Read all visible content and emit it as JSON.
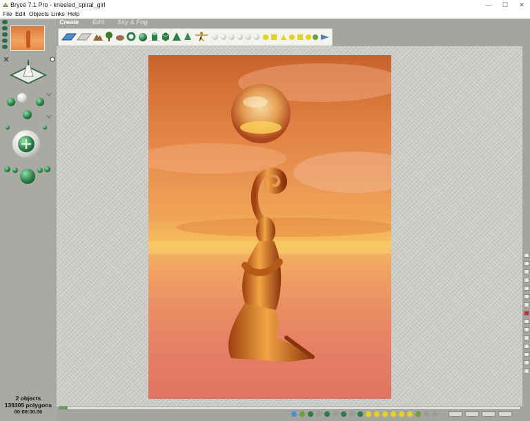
{
  "window": {
    "title": "Bryce 7.1  Pro - kneeled_spiral_girl",
    "minimize": "—",
    "maximize": "☐",
    "close": "✕"
  },
  "menu": {
    "items": [
      "File",
      "Edit",
      "Objects",
      "Links",
      "Help"
    ]
  },
  "palette_tabs": {
    "create": "Create",
    "edit": "Edit",
    "sky_fog": "Sky & Fog"
  },
  "status": {
    "objects": "2 objects",
    "polygons": "139305 polygons",
    "time": "00:00:00.00"
  },
  "colors": {
    "accent_green": "#2c7d47",
    "panel_gray": "#a9aaa3",
    "workspace": "#cfcfcc",
    "render_orange": "#e99352"
  }
}
